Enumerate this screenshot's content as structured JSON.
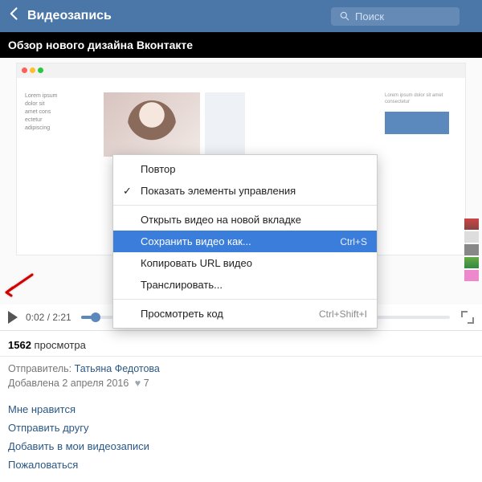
{
  "header": {
    "title": "Видеозапись",
    "search_placeholder": "Поиск"
  },
  "video": {
    "title": "Обзор нового дизайна Вконтакте",
    "current_time": "0:02",
    "duration": "2:21"
  },
  "context_menu": {
    "items": [
      {
        "label": "Повтор",
        "checked": false,
        "shortcut": ""
      },
      {
        "label": "Показать элементы управления",
        "checked": true,
        "shortcut": ""
      }
    ],
    "items2": [
      {
        "label": "Открыть видео на новой вкладке",
        "shortcut": "",
        "selected": false
      },
      {
        "label": "Сохранить видео как...",
        "shortcut": "Ctrl+S",
        "selected": true
      },
      {
        "label": "Копировать URL видео",
        "shortcut": "",
        "selected": false
      },
      {
        "label": "Транслировать...",
        "shortcut": "",
        "selected": false
      }
    ],
    "items3": [
      {
        "label": "Просмотреть код",
        "shortcut": "Ctrl+Shift+I",
        "selected": false
      }
    ]
  },
  "stats": {
    "views_count": "1562",
    "views_label": "просмотра"
  },
  "info": {
    "sender_label": "Отправитель:",
    "sender_name": "Татьяна Федотова",
    "added_label": "Добавлена",
    "added_date": "2 апреля 2016",
    "likes": "7"
  },
  "actions": {
    "like": "Мне нравится",
    "send": "Отправить другу",
    "add": "Добавить в мои видеозаписи",
    "report": "Пожаловаться"
  }
}
